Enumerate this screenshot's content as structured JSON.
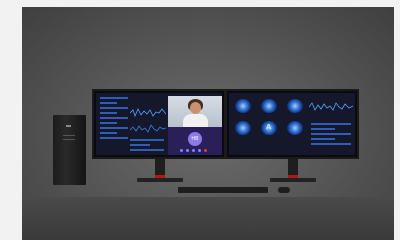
{
  "scene": {
    "background_color": "#555555",
    "accent_color": "#b01818"
  },
  "left_screen": {
    "video_call_avatar_initials": "HB"
  },
  "right_screen": {
    "scan_label": "A"
  }
}
